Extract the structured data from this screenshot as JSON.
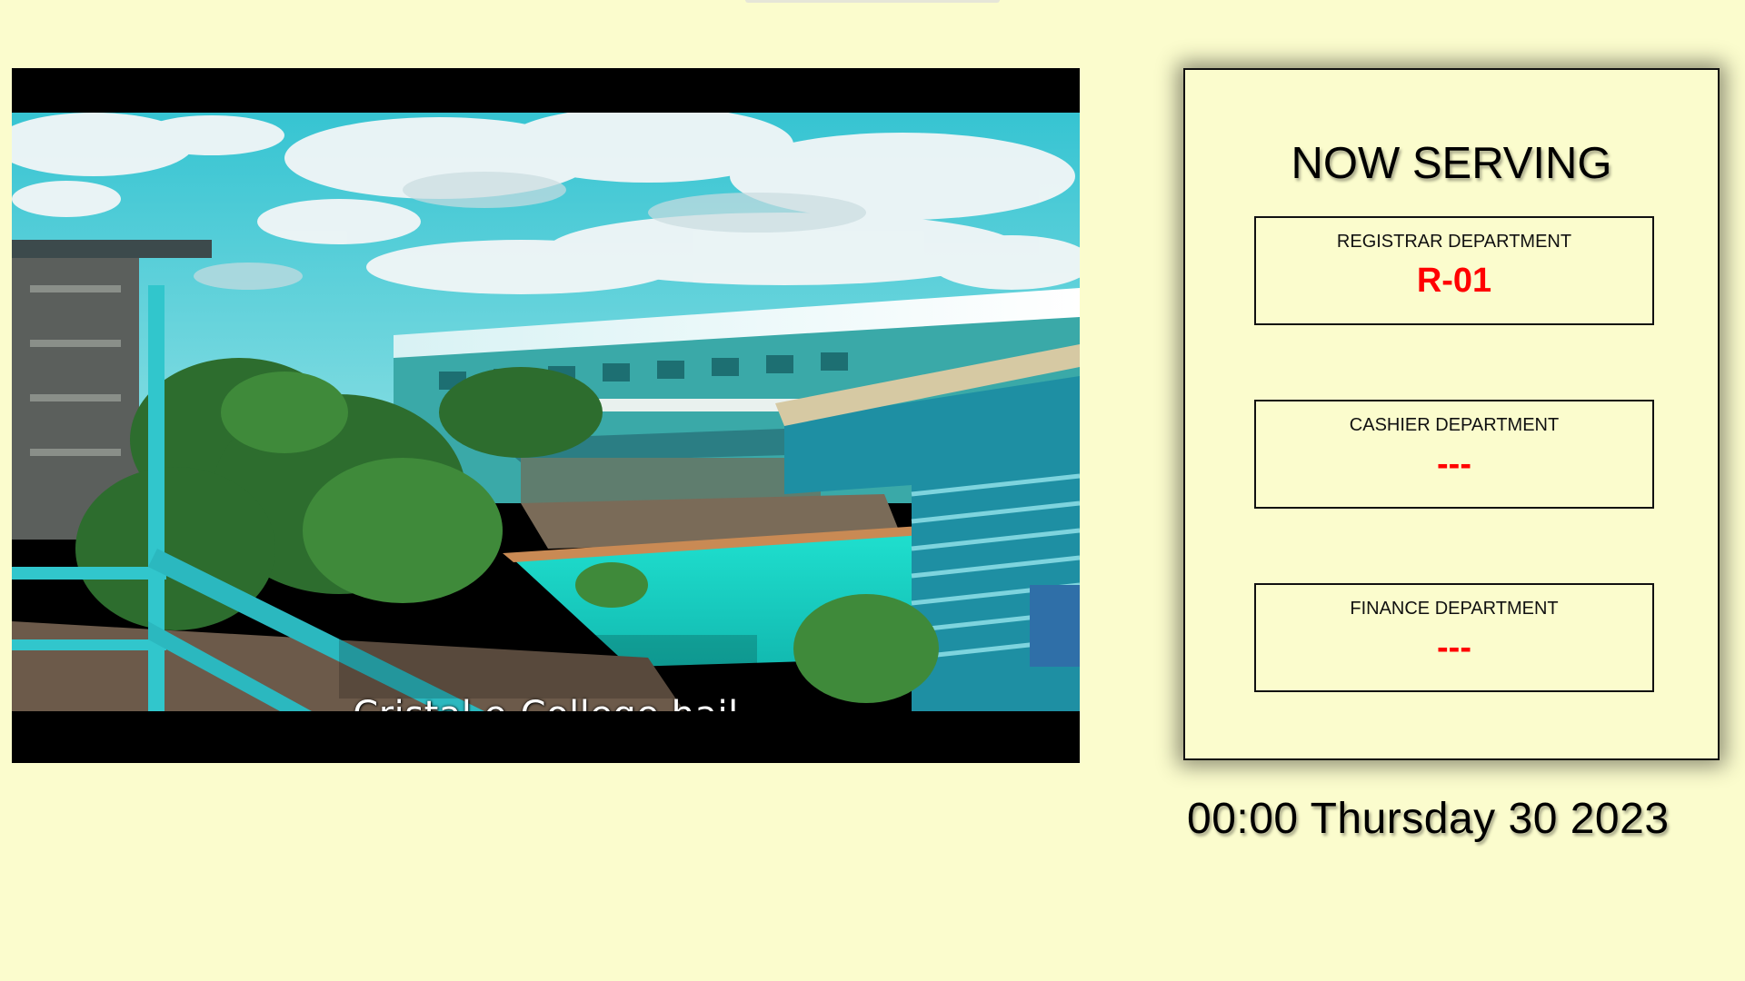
{
  "video": {
    "caption": "Cristal e-College hail"
  },
  "queue_board": {
    "title": "NOW SERVING",
    "departments": [
      {
        "name": "REGISTRAR DEPARTMENT",
        "number": "R-01"
      },
      {
        "name": "CASHIER DEPARTMENT",
        "number": "---"
      },
      {
        "name": "FINANCE DEPARTMENT",
        "number": "---"
      }
    ]
  },
  "clock": {
    "text": "00:00 Thursday 30 2023"
  },
  "colors": {
    "background": "#fbfccd",
    "number_accent": "#ff0000",
    "pool": "#22d8c8",
    "sky": "#4ad0d8"
  }
}
